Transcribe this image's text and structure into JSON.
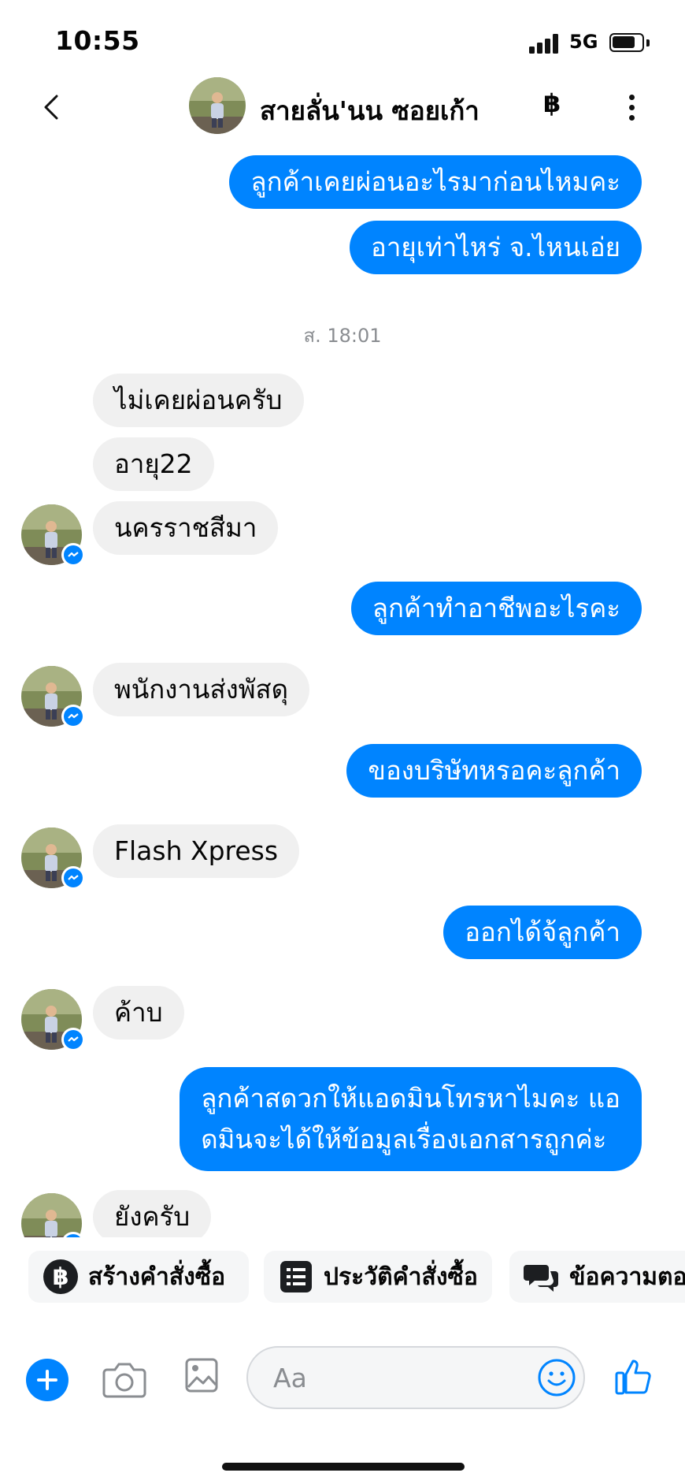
{
  "status_bar": {
    "time": "10:55",
    "network": "5G"
  },
  "header": {
    "contact_name": "สายลั่น'นน ซอยเก้า",
    "currency_symbol": "฿"
  },
  "messages": [
    {
      "dir": "out",
      "text": "ลูกค้าเคยผ่อนอะไรมาก่อนไหมคะ"
    },
    {
      "dir": "out",
      "text": "อายุเท่าไหร่ จ.ไหนเอ่ย"
    },
    {
      "dir": "in",
      "text": "ไม่เคยผ่อนครับ"
    },
    {
      "dir": "in",
      "text": "อายุ22"
    },
    {
      "dir": "in",
      "text": "นครราชสีมา"
    },
    {
      "dir": "out",
      "text": "ลูกค้าทำอาชีพอะไรคะ"
    },
    {
      "dir": "in",
      "text": "พนักงานส่งพัสดุ"
    },
    {
      "dir": "out",
      "text": "ของบริษัทหรอคะลูกค้า"
    },
    {
      "dir": "in",
      "text": "Flash Xpress"
    },
    {
      "dir": "out",
      "text": "ออกได้จ้ลูกค้า"
    },
    {
      "dir": "in",
      "text": "ค้าบ"
    },
    {
      "dir": "out",
      "lines": [
        "ลูกค้าสดวกให้แอดมินโทรหาไมคะ แอ",
        "ดมินจะได้ให้ข้อมูลเรื่องเอกสารถูกค่ะ"
      ]
    },
    {
      "dir": "in",
      "text": "ยังครับ"
    }
  ],
  "timestamp": "ส. 18:01",
  "quick_actions": [
    {
      "label": "สร้างคำสั่งซื้อ",
      "icon": "baht-circle-icon"
    },
    {
      "label": "ประวัติคำสั่งซื้อ",
      "icon": "order-list-icon"
    },
    {
      "label": "ข้อความตอ",
      "icon": "chat-bubbles-icon"
    }
  ],
  "composer": {
    "placeholder": "Aa"
  },
  "colors": {
    "accent": "#0084ff",
    "incoming_bubble": "#f0f0f0",
    "outgoing_text": "#ffffff"
  }
}
